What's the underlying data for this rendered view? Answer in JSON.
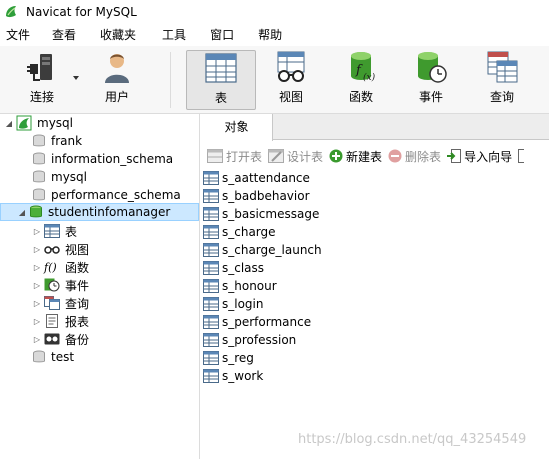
{
  "window": {
    "title": "Navicat for MySQL"
  },
  "menu": [
    "文件",
    "查看",
    "收藏夹",
    "工具",
    "窗口",
    "帮助"
  ],
  "toolbar": {
    "connect": "连接",
    "user": "用户",
    "table": "表",
    "view": "视图",
    "function": "函数",
    "event": "事件",
    "query": "查询"
  },
  "tree": {
    "root": "mysql",
    "databases": [
      "frank",
      "information_schema",
      "mysql",
      "performance_schema",
      "studentinfomanager"
    ],
    "children": [
      "表",
      "视图",
      "函数",
      "事件",
      "查询",
      "报表",
      "备份"
    ],
    "last": "test"
  },
  "panel": {
    "tab": "对象",
    "actions": {
      "open": "打开表",
      "design": "设计表",
      "new": "新建表",
      "delete": "删除表",
      "import": "导入向导"
    },
    "tables": [
      "s_aattendance",
      "s_badbehavior",
      "s_basicmessage",
      "s_charge",
      "s_charge_launch",
      "s_class",
      "s_honour",
      "s_login",
      "s_performance",
      "s_profession",
      "s_reg",
      "s_work"
    ]
  },
  "watermark": "https://blog.csdn.net/qq_43254549"
}
